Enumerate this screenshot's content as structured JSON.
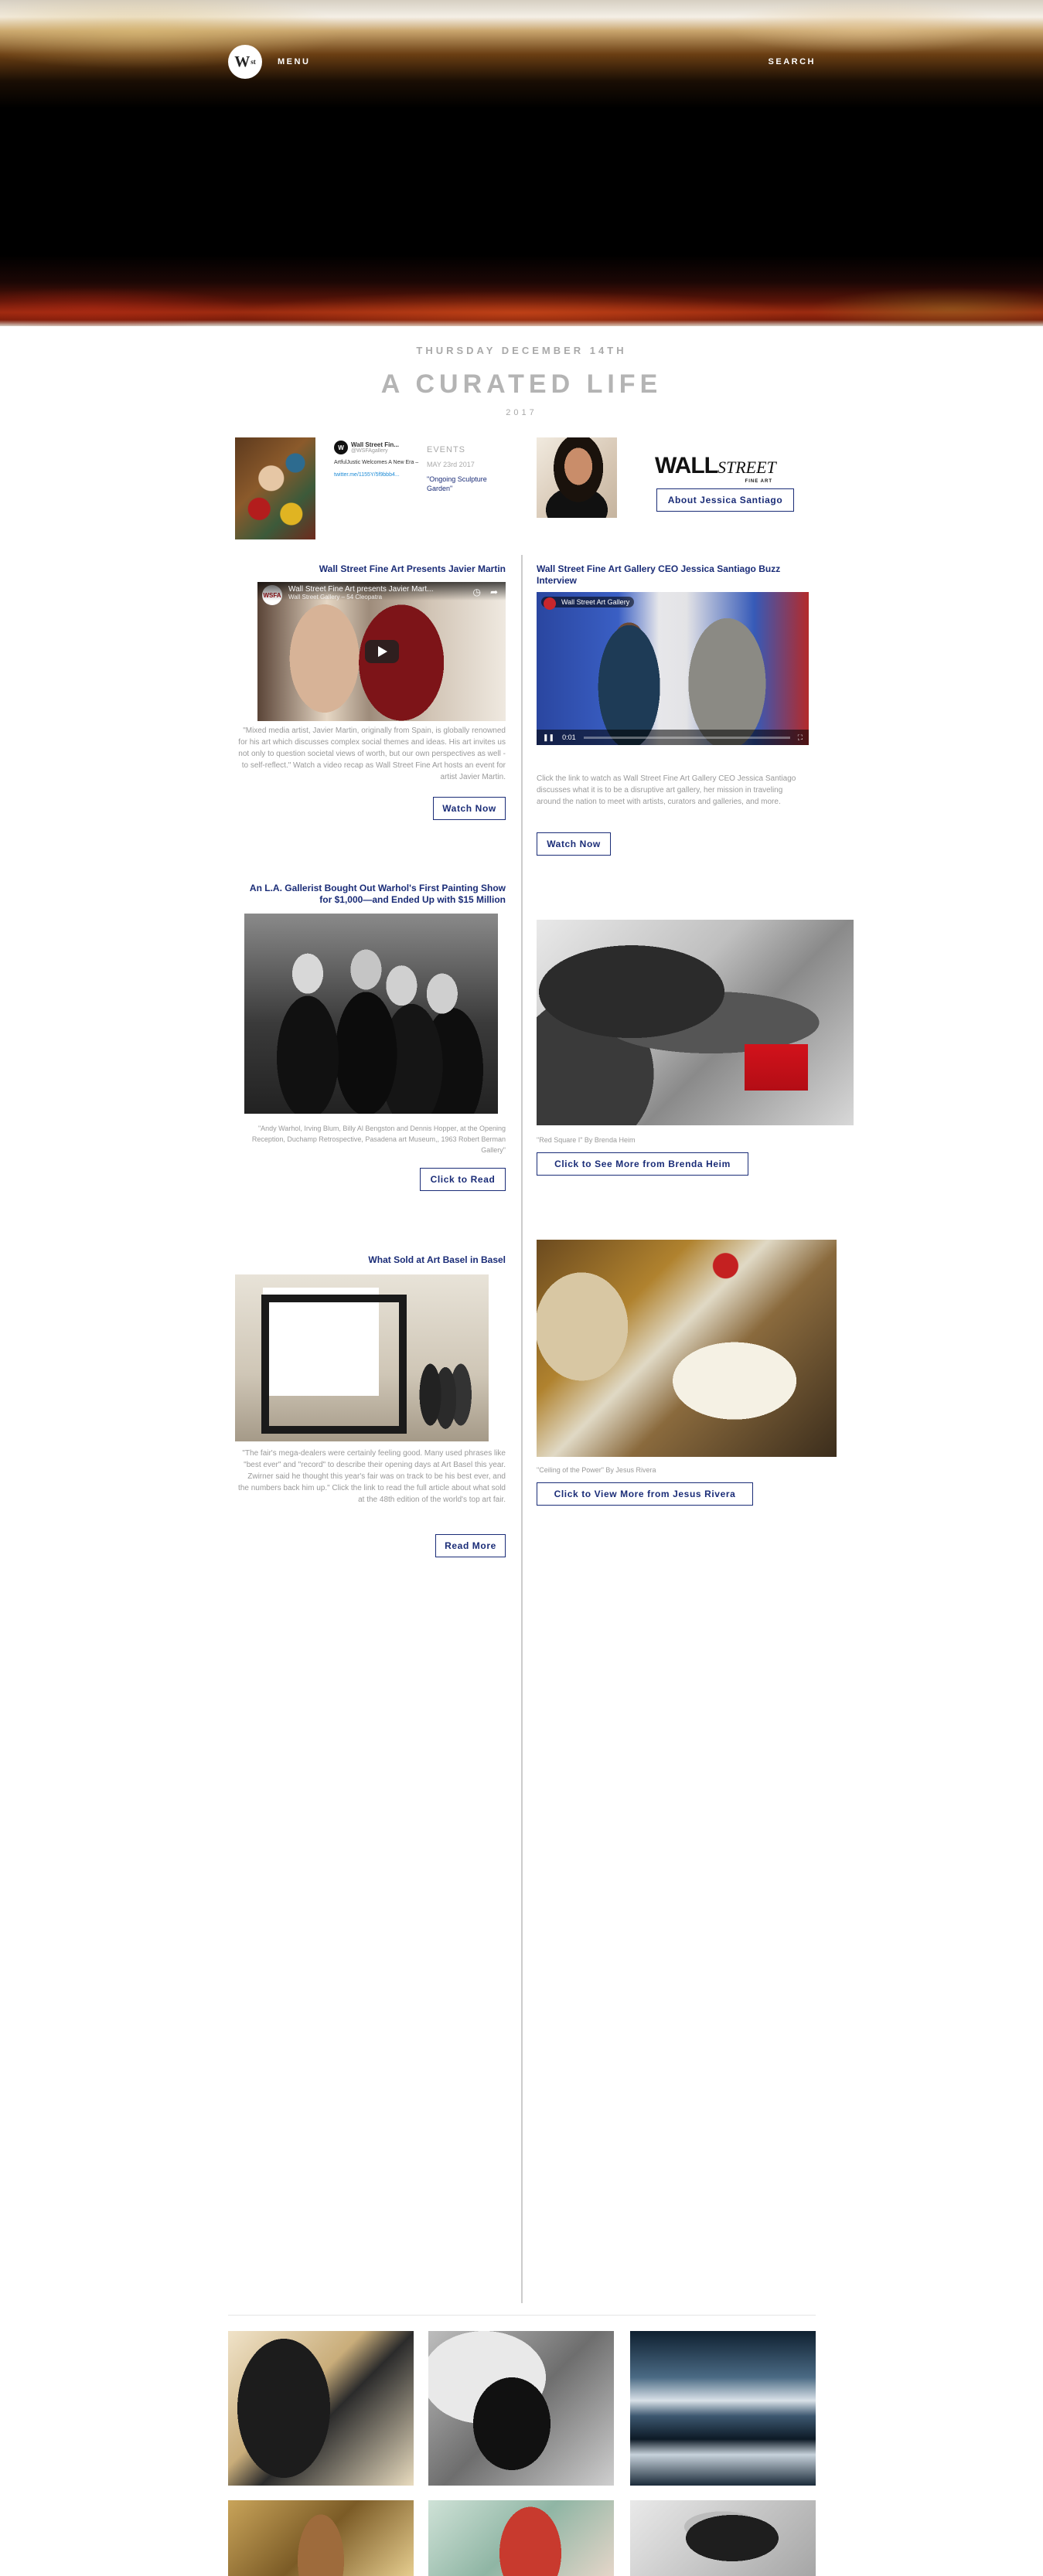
{
  "header": {
    "logo_text": "W",
    "logo_sup": "st",
    "menu_label": "MENU",
    "search_label": "SEARCH"
  },
  "intro": {
    "date": "THURSDAY DECEMBER 14TH",
    "title": "A CURATED LIFE",
    "year": "2017"
  },
  "strip": {
    "tweet": {
      "avatar_text": "W",
      "name": "Wall Street Fin...",
      "handle": "@WSFAgallery",
      "text": "ArtfulJustic Welcomes A New Era –",
      "link": "twitter.me/1155Y/5f9bbb4..."
    },
    "events": {
      "title": "EVENTS",
      "date": "MAY 23rd 2017",
      "item": "\"Ongoing Sculpture Garden\""
    },
    "ws_logo": {
      "big": "WALL",
      "street": "STREET",
      "fine": "FINE ART"
    },
    "about_button": "About Jessica Santiago"
  },
  "articles": {
    "a1": {
      "title": "Wall Street Fine Art Presents Javier Martin",
      "video_title": "Wall Street Fine Art presents Javier Mart...",
      "video_sub": "Wall Street Gallery – 54 Cleopatra",
      "video_channel": "WSFA",
      "body": "\"Mixed media artist, Javier Martin, originally from Spain, is globally renowned for his art which discusses complex social themes and ideas. His art invites us not only to question societal views of worth, but our own perspectives as well - to self-reflect.\" Watch a video recap as Wall Street Fine Art hosts an event for artist Javier Martin.",
      "button": "Watch Now"
    },
    "a2": {
      "title": "Wall Street Fine Art Gallery CEO Jessica Santiago Buzz Interview",
      "video_label": "Wall Street Art Gallery",
      "video_time": "0:01",
      "body": "Click the link to watch as Wall Street Fine Art Gallery CEO Jessica Santiago discusses what it is to be a disruptive art gallery, her mission in traveling around the nation to meet with artists, curators and galleries, and more.",
      "button": "Watch Now"
    },
    "a3": {
      "title": "An L.A. Gallerist Bought Out Warhol's First Painting Show for $1,000—and Ended Up with $15 Million",
      "caption": "\"Andy Warhol, Irving Blum, Billy Al Bengston and Dennis Hopper, at the Opening Reception, Duchamp Retrospective, Pasadena art Museum,, 1963 Robert Berman Gallery\"",
      "button": "Click to Read"
    },
    "a4": {
      "caption": "\"Red Square I\" By Brenda Heim",
      "button": "Click to See More from Brenda Heim"
    },
    "a5": {
      "title": "What Sold at Art Basel in Basel",
      "body": "\"The fair's mega-dealers were certainly feeling good. Many used phrases like \"best ever\" and \"record\" to describe their opening days at Art Basel this year. Zwirner said he thought this year's fair was on track to be his best ever, and the numbers back him up.\" Click the link to read the full article about what sold at the 48th edition of the world's top art fair.",
      "button": "Read More"
    },
    "a6": {
      "caption": "\"Ceiling of the Power\" By Jesus Rivera",
      "button": "Click to View More from Jesus Rivera"
    }
  }
}
